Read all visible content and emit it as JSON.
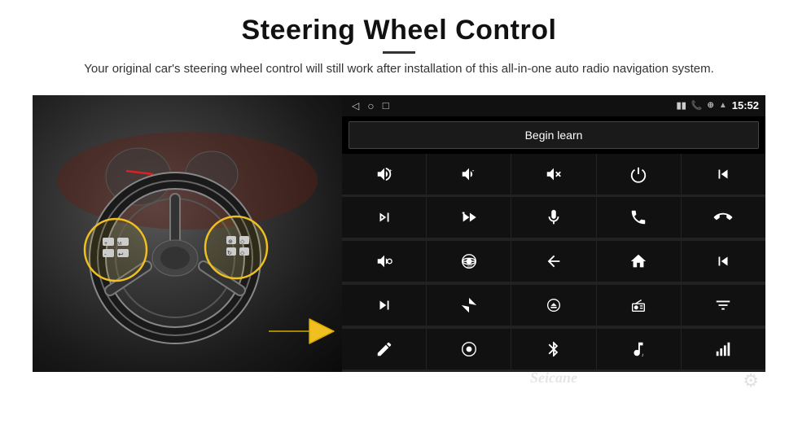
{
  "header": {
    "title": "Steering Wheel Control",
    "subtitle": "Your original car's steering wheel control will still work after installation of this all-in-one auto radio navigation system."
  },
  "statusbar": {
    "nav_back": "◁",
    "nav_home": "○",
    "nav_recent": "□",
    "signal": "▮▮",
    "battery": "🔋",
    "phone": "📞",
    "location": "⊕",
    "wifi": "▲",
    "time": "15:52"
  },
  "begin_learn": {
    "label": "Begin learn"
  },
  "icon_grid": [
    {
      "id": "vol-up",
      "symbol": "vol_up"
    },
    {
      "id": "vol-down",
      "symbol": "vol_down"
    },
    {
      "id": "mute",
      "symbol": "mute"
    },
    {
      "id": "power",
      "symbol": "power"
    },
    {
      "id": "prev-track",
      "symbol": "prev_track"
    },
    {
      "id": "skip-forward",
      "symbol": "skip_fwd"
    },
    {
      "id": "fast-forward",
      "symbol": "fast_fwd"
    },
    {
      "id": "mic",
      "symbol": "mic"
    },
    {
      "id": "phone",
      "symbol": "phone"
    },
    {
      "id": "hang-up",
      "symbol": "hang_up"
    },
    {
      "id": "horn",
      "symbol": "horn"
    },
    {
      "id": "360-cam",
      "symbol": "cam360"
    },
    {
      "id": "back",
      "symbol": "back_arrow"
    },
    {
      "id": "home",
      "symbol": "home"
    },
    {
      "id": "rewind",
      "symbol": "rewind"
    },
    {
      "id": "next-track",
      "symbol": "next_track"
    },
    {
      "id": "nav",
      "symbol": "nav_arrow"
    },
    {
      "id": "eject",
      "symbol": "eject"
    },
    {
      "id": "radio",
      "symbol": "radio"
    },
    {
      "id": "equalizer",
      "symbol": "eq"
    },
    {
      "id": "pen",
      "symbol": "pen"
    },
    {
      "id": "360-circle",
      "symbol": "circle_dot"
    },
    {
      "id": "bluetooth",
      "symbol": "bluetooth"
    },
    {
      "id": "music",
      "symbol": "music"
    },
    {
      "id": "bars",
      "symbol": "bars"
    }
  ],
  "watermark": "Seicane",
  "gear_label": "⚙"
}
